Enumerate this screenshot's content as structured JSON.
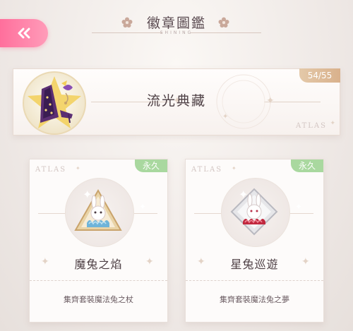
{
  "header": {
    "title": "徽章圖鑑",
    "subtitle": "SHINING"
  },
  "banner": {
    "title": "流光典藏",
    "count": "54/55",
    "atlas": "ATLAS"
  },
  "cards": [
    {
      "name": "魔兔之焰",
      "tag": "永久",
      "atlas": "ATLAS",
      "desc": "集齊套裝魔法兔之杖"
    },
    {
      "name": "星兔巡遊",
      "tag": "永久",
      "atlas": "ATLAS",
      "desc": "集齊套裝魔法兔之夢"
    }
  ],
  "colors": {
    "accent_pink": "#ff7aa2",
    "gold_tag": "#dcb590",
    "green_tag": "#a9d89f"
  }
}
